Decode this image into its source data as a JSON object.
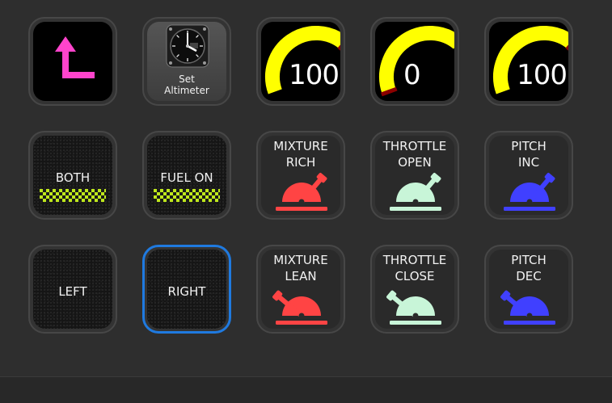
{
  "row1": {
    "back_icon": "up-left-arrow-icon",
    "altimeter": {
      "icon": "altimeter-instrument-icon",
      "label_line1": "Set",
      "label_line2": "Altimeter"
    },
    "gauges": [
      {
        "value": "100",
        "level": 1.0
      },
      {
        "value": "0",
        "level": 0.0
      },
      {
        "value": "100",
        "level": 1.0
      }
    ]
  },
  "row2": {
    "both": {
      "label": "BOTH"
    },
    "fuel_on": {
      "label": "FUEL ON"
    },
    "mixture_rich": {
      "line1": "MIXTURE",
      "line2": "RICH",
      "icon": "mixture-lever-icon"
    },
    "throttle_open": {
      "line1": "THROTTLE",
      "line2": "OPEN",
      "icon": "throttle-lever-icon"
    },
    "pitch_inc": {
      "line1": "PITCH",
      "line2": "INC",
      "icon": "pitch-lever-icon"
    }
  },
  "row3": {
    "left": {
      "label": "LEFT"
    },
    "right": {
      "label": "RIGHT"
    },
    "mixture_lean": {
      "line1": "MIXTURE",
      "line2": "LEAN",
      "icon": "mixture-lever-icon"
    },
    "throttle_close": {
      "line1": "THROTTLE",
      "line2": "CLOSE",
      "icon": "throttle-lever-icon"
    },
    "pitch_dec": {
      "line1": "PITCH",
      "line2": "DEC",
      "icon": "pitch-lever-icon"
    }
  },
  "colors": {
    "mixture": "#ff4444",
    "throttle": "#c8f5d8",
    "pitch": "#4040ff",
    "gauge_arc": "#ffff00",
    "gauge_redline": "#8b0000",
    "back_arrow": "#ff44cc",
    "selection": "#1f7ae0",
    "checker": "#bfe81c"
  }
}
